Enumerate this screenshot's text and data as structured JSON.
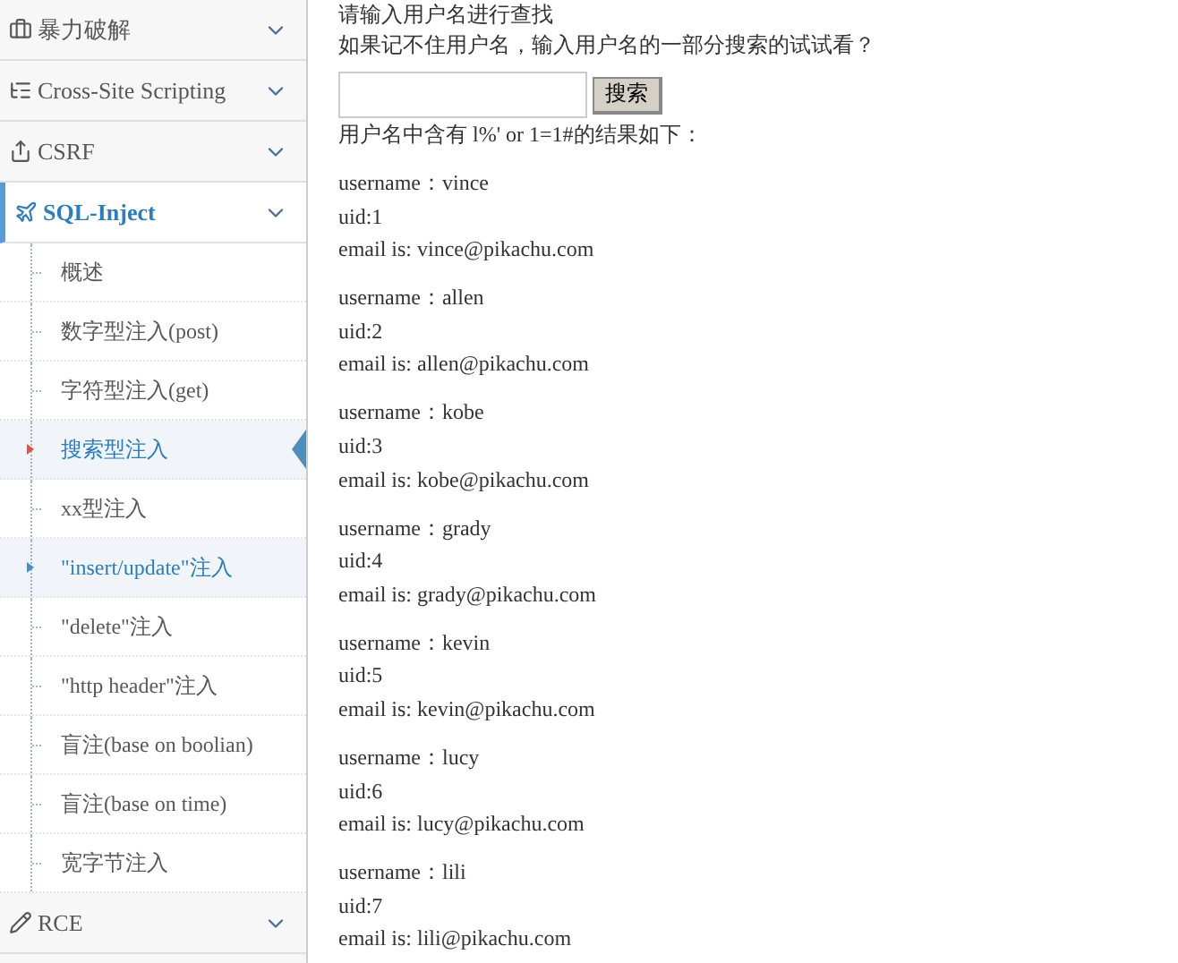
{
  "sidebar": {
    "sections": [
      {
        "label": "暴力破解",
        "expanded": false
      },
      {
        "label": "Cross-Site Scripting",
        "expanded": false
      },
      {
        "label": "CSRF",
        "expanded": false
      },
      {
        "label": "SQL-Inject",
        "expanded": true,
        "children": [
          {
            "label": "概述",
            "selected": false,
            "highlighted": false
          },
          {
            "label": "数字型注入(post)",
            "selected": false,
            "highlighted": false
          },
          {
            "label": "字符型注入(get)",
            "selected": false,
            "highlighted": false
          },
          {
            "label": "搜索型注入",
            "selected": true,
            "highlighted": false
          },
          {
            "label": "xx型注入",
            "selected": false,
            "highlighted": false
          },
          {
            "label": "\"insert/update\"注入",
            "selected": false,
            "highlighted": true
          },
          {
            "label": "\"delete\"注入",
            "selected": false,
            "highlighted": false
          },
          {
            "label": "\"http header\"注入",
            "selected": false,
            "highlighted": false
          },
          {
            "label": "盲注(base on boolian)",
            "selected": false,
            "highlighted": false
          },
          {
            "label": "盲注(base on time)",
            "selected": false,
            "highlighted": false
          },
          {
            "label": "宽字节注入",
            "selected": false,
            "highlighted": false
          }
        ]
      },
      {
        "label": "RCE",
        "expanded": false
      }
    ]
  },
  "main": {
    "prompt": "请输入用户名进行查找",
    "hint": "如果记不住用户名，输入用户名的一部分搜索的试试看？",
    "search_button": "搜索",
    "result_heading": "用户名中含有 l%' or 1=1#的结果如下：",
    "results": [
      {
        "username": "username：vince",
        "uid": "uid:1",
        "email": "email is: vince@pikachu.com"
      },
      {
        "username": "username：allen",
        "uid": "uid:2",
        "email": "email is: allen@pikachu.com"
      },
      {
        "username": "username：kobe",
        "uid": "uid:3",
        "email": "email is: kobe@pikachu.com"
      },
      {
        "username": "username：grady",
        "uid": "uid:4",
        "email": "email is: grady@pikachu.com"
      },
      {
        "username": "username：kevin",
        "uid": "uid:5",
        "email": "email is: kevin@pikachu.com"
      },
      {
        "username": "username：lucy",
        "uid": "uid:6",
        "email": "email is: lucy@pikachu.com"
      },
      {
        "username": "username：lili",
        "uid": "uid:7",
        "email": "email is: lili@pikachu.com"
      }
    ]
  }
}
